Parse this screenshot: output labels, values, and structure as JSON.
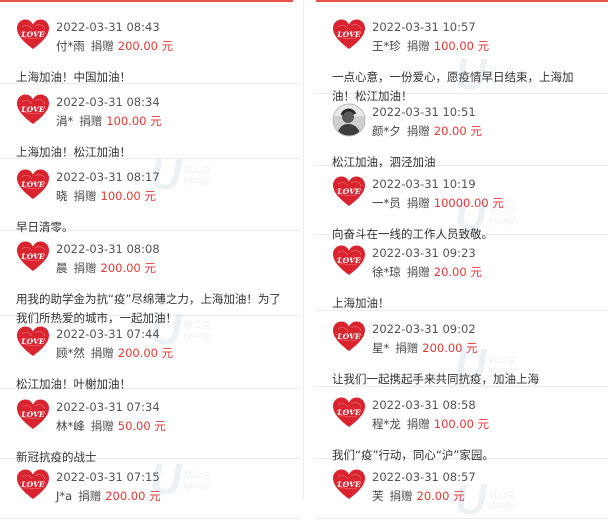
{
  "amount_color": "#e53935",
  "accent": "#e8534f",
  "watermark": {
    "icon": "u-logo-icon",
    "text": "联公益",
    "sub": "lgongyi"
  },
  "left_entries": [
    {
      "avatar": "love-heart-icon",
      "date": "2022-03-31 08:43",
      "name": "付*雨",
      "verb": "捐赠",
      "amount": "200.00 元",
      "message": "上海加油！中国加油！"
    },
    {
      "avatar": "love-heart-icon",
      "date": "2022-03-31 08:34",
      "name": "涓*",
      "verb": "捐赠",
      "amount": "100.00 元",
      "message": "上海加油！松江加油！"
    },
    {
      "avatar": "love-heart-icon",
      "date": "2022-03-31 08:17",
      "name": "晓",
      "verb": "捐赠",
      "amount": "100.00 元",
      "message": "早日清零。"
    },
    {
      "avatar": "love-heart-icon",
      "date": "2022-03-31 08:08",
      "name": "晨",
      "verb": "捐赠",
      "amount": "200.00 元",
      "message": "用我的助学金为抗“疫”尽绵薄之力，上海加油！为了我们所热爱的城市，一起加油！"
    },
    {
      "avatar": "love-heart-icon",
      "date": "2022-03-31 07:44",
      "name": "顾*然",
      "verb": "捐赠",
      "amount": "200.00 元",
      "message": "松江加油！叶榭加油！"
    },
    {
      "avatar": "love-heart-icon",
      "date": "2022-03-31 07:34",
      "name": "林*峰",
      "verb": "捐赠",
      "amount": "50.00 元",
      "message": "新冠抗疫的战士"
    },
    {
      "avatar": "love-heart-icon",
      "date": "2022-03-31 07:15",
      "name": "J*a",
      "verb": "捐赠",
      "amount": "200.00 元",
      "message": ""
    }
  ],
  "right_entries": [
    {
      "avatar": "love-heart-icon",
      "date": "2022-03-31 10:57",
      "name": "王*珍",
      "verb": "捐赠",
      "amount": "100.00 元",
      "message": "一点心意，一份爱心，愿疫情早日结束，上海加油！松江加油！"
    },
    {
      "avatar": "photo-avatar-icon",
      "date": "2022-03-31 10:51",
      "name": "颜*夕",
      "verb": "捐赠",
      "amount": "20.00 元",
      "message": "松江加油，泗泾加油"
    },
    {
      "avatar": "love-heart-icon",
      "date": "2022-03-31 10:19",
      "name": "一*员",
      "verb": "捐赠",
      "amount": "10000.00 元",
      "message": "向奋斗在一线的工作人员致敬。"
    },
    {
      "avatar": "love-heart-icon",
      "date": "2022-03-31 09:23",
      "name": "徐*琼",
      "verb": "捐赠",
      "amount": "20.00 元",
      "message": "上海加油！"
    },
    {
      "avatar": "love-heart-icon",
      "date": "2022-03-31 09:02",
      "name": "星*",
      "verb": "捐赠",
      "amount": "200.00 元",
      "message": "让我们一起携起手来共同抗疫，加油上海"
    },
    {
      "avatar": "love-heart-icon",
      "date": "2022-03-31 08:58",
      "name": "程*龙",
      "verb": "捐赠",
      "amount": "100.00 元",
      "message": "我们“疫”行动，同心“沪”家园。"
    },
    {
      "avatar": "love-heart-icon",
      "date": "2022-03-31 08:57",
      "name": "芙",
      "verb": "捐赠",
      "amount": "20.00 元",
      "message": ""
    }
  ]
}
